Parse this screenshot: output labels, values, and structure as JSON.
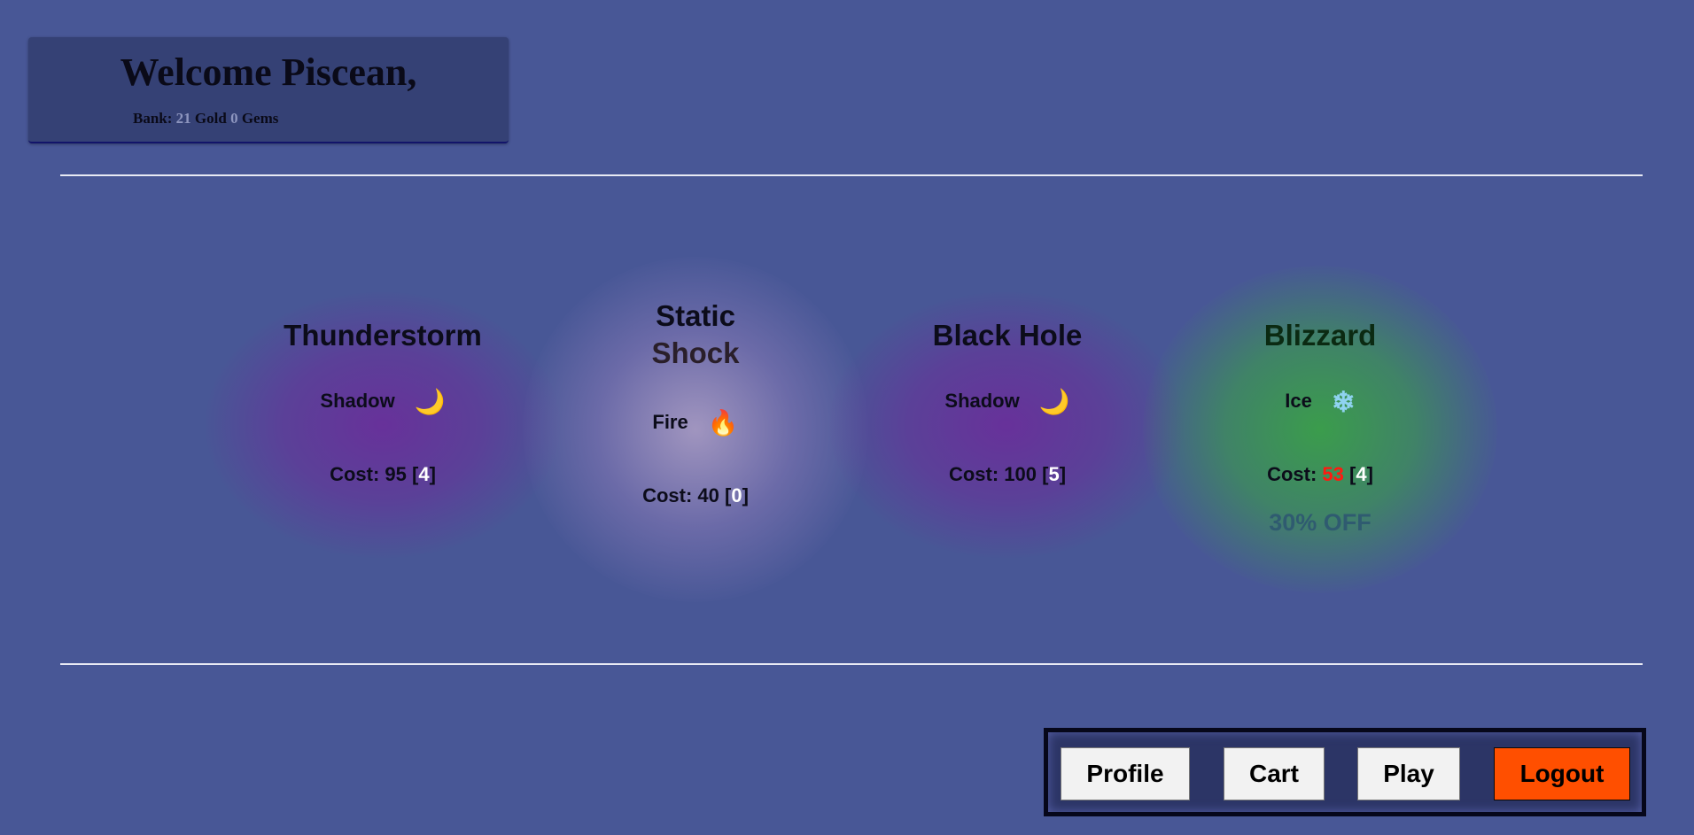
{
  "welcome": {
    "title": "Welcome Piscean,",
    "bank_label": "Bank:",
    "gold_amount": "21",
    "gold_label": "Gold",
    "gems_amount": "0",
    "gems_label": "Gems"
  },
  "cards": [
    {
      "title_line1": "Thunderstorm",
      "element": "Shadow",
      "icon": "crescent-moon-icon",
      "icon_glyph": "🌙",
      "cost_label": "Cost:",
      "cost": "95",
      "level": "4",
      "glow_color": "#6a2e9a"
    },
    {
      "title_line1": "Static",
      "title_line2": "Shock",
      "element": "Fire",
      "icon": "fire-icon",
      "icon_glyph": "🔥",
      "cost_label": "Cost:",
      "cost": "40",
      "level": "0",
      "glow_color": "#b3a0c8"
    },
    {
      "title_line1": "Black Hole",
      "element": "Shadow",
      "icon": "crescent-moon-icon",
      "icon_glyph": "🌙",
      "cost_label": "Cost:",
      "cost": "100",
      "level": "5",
      "glow_color": "#6a2e9a"
    },
    {
      "title_line1": "Blizzard",
      "element": "Ice",
      "icon": "snowflake-icon",
      "icon_glyph": "❄",
      "cost_label": "Cost:",
      "cost": "53",
      "level": "4",
      "discount": "30% OFF",
      "glow_color": "#3aa048"
    }
  ],
  "nav": {
    "profile": "Profile",
    "cart": "Cart",
    "play": "Play",
    "logout": "Logout"
  },
  "colors": {
    "background": "#485796",
    "logout_button": "#ff4f00",
    "sale_price": "#ff1a10",
    "discount_text": "#2f5b70",
    "ice_title": "#0b2a12",
    "static_shock_line2": "#2a1f2a"
  }
}
